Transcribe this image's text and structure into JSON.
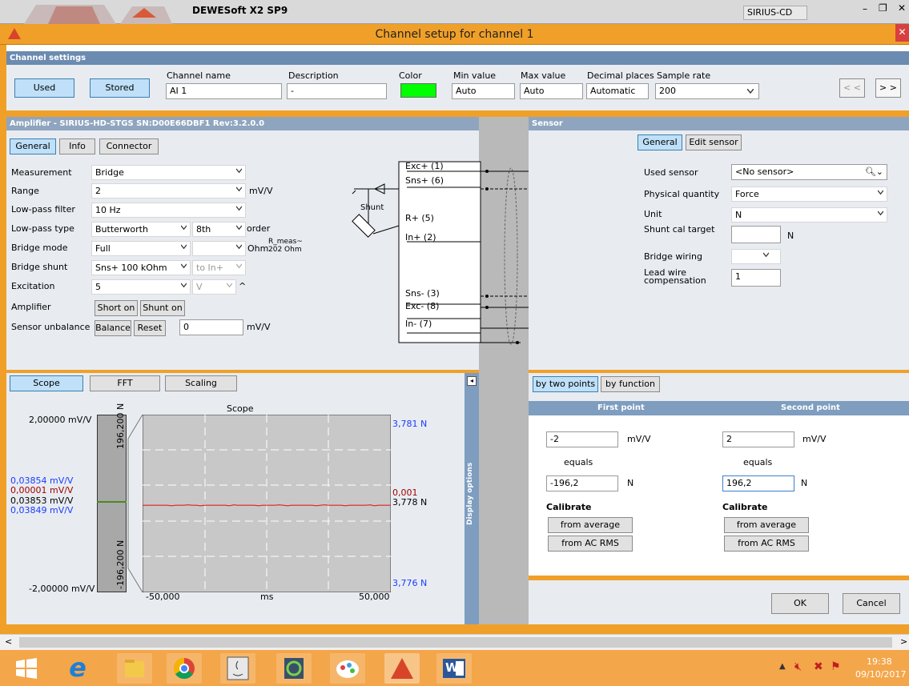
{
  "app": {
    "title": "DEWESoft X2 SP9",
    "device": "SIRIUS-CD",
    "window_title": "Channel setup for channel 1"
  },
  "channel_settings": {
    "header": "Channel settings",
    "used_label": "Used",
    "stored_label": "Stored",
    "name_label": "Channel name",
    "name_value": "AI 1",
    "description_label": "Description",
    "description_value": "-",
    "color_label": "Color",
    "color_value": "#00ff00",
    "min_label": "Min value",
    "min_value": "Auto",
    "max_label": "Max value",
    "max_value": "Auto",
    "decimal_label": "Decimal places",
    "decimal_value": "Automatic",
    "rate_label": "Sample rate",
    "rate_value": "200",
    "prev_label": "< <",
    "next_label": "> >"
  },
  "amplifier": {
    "header": "Amplifier - SIRIUS-HD-STGS  SN:D00E66DBF1 Rev:3.2.0.0",
    "tabs": [
      "General",
      "Info",
      "Connector"
    ],
    "rows": {
      "measurement_label": "Measurement",
      "measurement_value": "Bridge",
      "range_label": "Range",
      "range_value": "2",
      "range_unit": "mV/V",
      "lowpass_label": "Low-pass filter",
      "lowpass_value": "10 Hz",
      "lptype_label": "Low-pass type",
      "lptype_value": "Butterworth",
      "order_value": "8th",
      "order_label": "order",
      "bridge_mode_label": "Bridge mode",
      "bridge_mode_value": "Full",
      "ohm_label": "Ohm",
      "rmeas_label": "R_meas~",
      "rmeas_value": "202 Ohm",
      "shunt_label": "Bridge shunt",
      "shunt_value": "Sns+ 100 kOhm",
      "shunt_to": "to In+",
      "excitation_label": "Excitation",
      "excitation_value": "5",
      "excitation_unit": "V",
      "caret": "^",
      "amplifier_label": "Amplifier",
      "short_on": "Short on",
      "shunt_on": "Shunt on",
      "unbalance_label": "Sensor unbalance",
      "balance": "Balance",
      "reset": "Reset",
      "unbalance_value": "0",
      "unbalance_unit": "mV/V"
    },
    "diagram": {
      "exc_plus": "Exc+ (1)",
      "sns_plus": "Sns+ (6)",
      "shunt": "Shunt",
      "r_plus": "R+ (5)",
      "in_plus": "In+ (2)",
      "sns_minus": "Sns- (3)",
      "exc_minus": "Exc- (8)",
      "in_minus": "In- (7)"
    }
  },
  "sensor": {
    "header": "Sensor",
    "general_label": "General",
    "edit_label": "Edit sensor",
    "used_sensor_label": "Used sensor",
    "used_sensor_value": "<No sensor>",
    "quantity_label": "Physical quantity",
    "quantity_value": "Force",
    "unit_label": "Unit",
    "unit_value": "N",
    "shunt_cal_label": "Shunt cal target",
    "shunt_cal_unit": "N",
    "wiring_label": "Bridge wiring",
    "lead_label_1": "Lead wire",
    "lead_label_2": "compensation",
    "lead_value": "1"
  },
  "scope": {
    "tabs": [
      "Scope",
      "FFT",
      "Scaling"
    ],
    "title": "Scope",
    "left_max": "2,00000 mV/V",
    "left_min": "-2,00000 mV/V",
    "readouts": [
      "0,03854 mV/V",
      "0,00001 mV/V",
      "0,03853 mV/V",
      "0,03849 mV/V"
    ],
    "bar_top": "196,200 N",
    "bar_bottom": "-196,200 N",
    "right_max": "3,781 N",
    "right_mid1": "0,001",
    "right_mid2": "3,778 N",
    "right_min": "3,776 N",
    "x_min": "-50,000",
    "x_unit": "ms",
    "x_max": "50,000",
    "display_options": "Display options",
    "collapse": "◂",
    "signal_fraction": 0.49
  },
  "scaling": {
    "tabs": [
      "by two points",
      "by function"
    ],
    "first_header": "First point",
    "second_header": "Second point",
    "p1_in": "-2",
    "p1_in_unit": "mV/V",
    "p1_eq": "equals",
    "p1_out": "-196,2",
    "p1_out_unit": "N",
    "p2_in": "2",
    "p2_in_unit": "mV/V",
    "p2_eq": "equals",
    "p2_out": "196,2",
    "p2_out_unit": "N",
    "calibrate": "Calibrate",
    "from_average": "from average",
    "from_ac_rms": "from AC RMS"
  },
  "dialog": {
    "ok": "OK",
    "cancel": "Cancel"
  },
  "taskbar": {
    "time": "19:38",
    "date": "09/10/2017",
    "word": "W"
  },
  "colors": {
    "accent": "#f0a028",
    "header": "#6b8bb0",
    "signal": "#e02020",
    "blue_text": "#1a3cff",
    "red_text": "#a00000"
  }
}
